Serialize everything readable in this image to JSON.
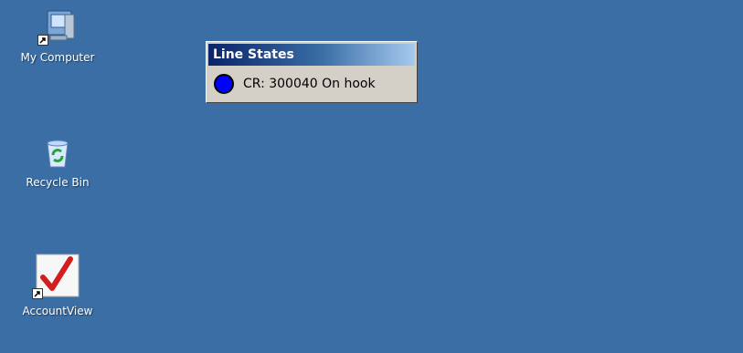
{
  "desktop": {
    "background_color": "#3a6ea5",
    "icons": [
      {
        "label": "My Computer",
        "icon": "my-computer-icon"
      },
      {
        "label": "Recycle Bin",
        "icon": "recycle-bin-icon"
      },
      {
        "label": "AccountView",
        "icon": "accountview-icon"
      }
    ]
  },
  "line_states": {
    "title": "Line States",
    "status_color": "#0000ff",
    "line_text": "CR: 300040 On hook"
  }
}
